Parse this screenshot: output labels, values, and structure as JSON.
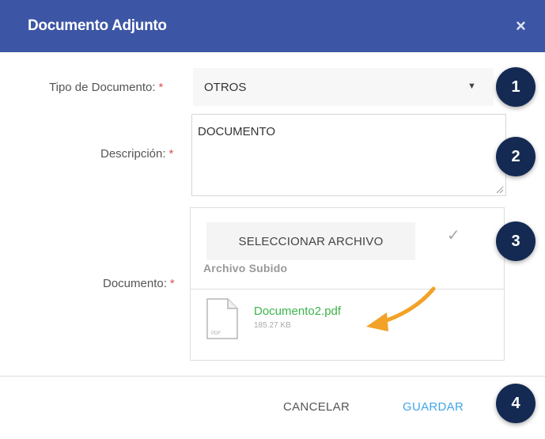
{
  "dialog": {
    "title": "Documento Adjunto",
    "close_glyph": "×",
    "header_color": "#3c55a5"
  },
  "form": {
    "tipo": {
      "label": "Tipo de Documento:",
      "required": "*",
      "value": "OTROS"
    },
    "descripcion": {
      "label": "Descripción:",
      "required": "*",
      "value": "DOCUMENTO"
    },
    "documento": {
      "label": "Documento:",
      "required": "*",
      "select_button": "SELECCIONAR ARCHIVO",
      "uploaded_label": "Archivo Subido",
      "file": {
        "name": "Documento2.pdf",
        "size": "185.27 KB",
        "icon_text": "PDF",
        "icon": "pdf-file-icon"
      }
    }
  },
  "footer": {
    "cancel_label": "CANCELAR",
    "save_label": "GUARDAR"
  },
  "badges": [
    "1",
    "2",
    "3",
    "4"
  ],
  "colors": {
    "accent": "#42a5e8",
    "file_link": "#3db44a",
    "badge": "#142a52",
    "arrow": "#f2a227",
    "required": "#d9534f"
  }
}
